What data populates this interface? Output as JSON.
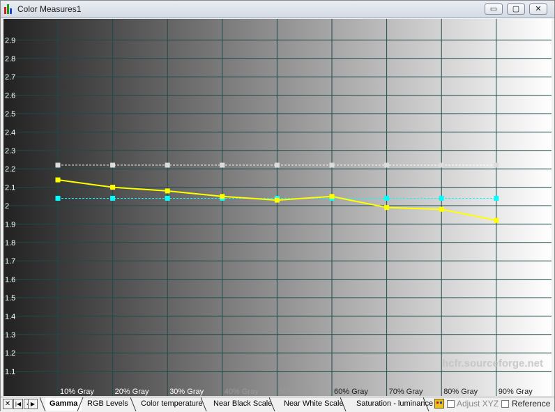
{
  "window": {
    "title": "Color Measures1"
  },
  "title_buttons": {
    "minimize": "▭",
    "maximize": "▢",
    "close": "✕"
  },
  "chart_data": {
    "type": "line",
    "title": "",
    "xlabel": "",
    "ylabel": "",
    "ylim": [
      1.0,
      3.0
    ],
    "y_ticks": [
      "1.1",
      "1.2",
      "1.3",
      "1.4",
      "1.5",
      "1.6",
      "1.7",
      "1.8",
      "1.9",
      "2",
      "2.1",
      "2.2",
      "2.3",
      "2.4",
      "2.5",
      "2.6",
      "2.7",
      "2.8",
      "2.9"
    ],
    "categories": [
      "10% Gray",
      "20% Gray",
      "30% Gray",
      "40% Gray",
      "50% Gray",
      "60% Gray",
      "70% Gray",
      "80% Gray",
      "90% Gray"
    ],
    "series": [
      {
        "color": "#ffff00",
        "style": "solid",
        "values": [
          2.14,
          2.1,
          2.08,
          2.05,
          2.03,
          2.05,
          1.99,
          1.98,
          1.92
        ]
      },
      {
        "color": "#00ffff",
        "style": "dashed",
        "values": [
          2.04,
          2.04,
          2.04,
          2.04,
          2.04,
          2.04,
          2.04,
          2.04,
          2.04
        ]
      },
      {
        "color": "#ffffff",
        "style": "dashed",
        "values": [
          2.22,
          2.22,
          2.22,
          2.22,
          2.22,
          2.22,
          2.22,
          2.22,
          2.22
        ]
      }
    ],
    "grid": true,
    "background": "gray gradient, dark to light",
    "watermark": "hcfr.sourceforge.net"
  },
  "nav": {
    "close": "✕",
    "first": "◀",
    "prev": "◀",
    "next": "▶"
  },
  "tabs": [
    "Gamma",
    "RGB Levels",
    "Color temperature",
    "Near Black Scale",
    "Near White Scale",
    "Saturation - luminance"
  ],
  "options": {
    "adjust_xyz": "Adjust XYZ",
    "reference": "Reference"
  }
}
